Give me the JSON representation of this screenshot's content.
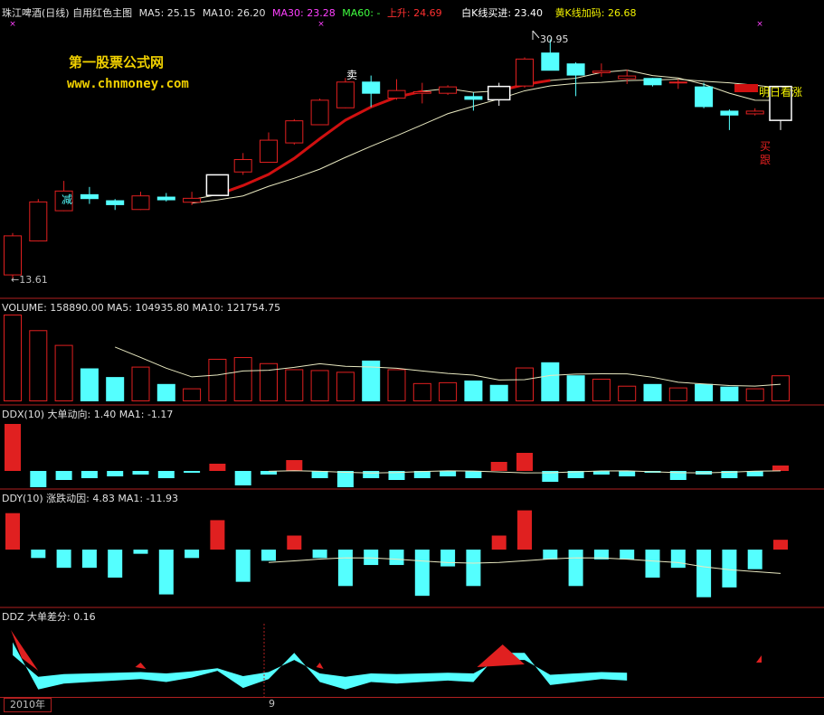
{
  "main": {
    "title": "珠江啤酒(日线) 自用红色主图",
    "ma5": "MA5: 25.15",
    "ma10": "MA10: 26.20",
    "ma30": "MA30: 23.28",
    "ma60": "MA60: -",
    "rise": "上升: 24.69",
    "white_k": "白K线买进: 23.40",
    "yellow_k": "黄K线加码: 26.68",
    "watermark_cn": "第一股票公式网",
    "watermark_url": "www.chnmoney.com",
    "high_label": "30.95",
    "low_label": "←13.61",
    "sell_label": "卖",
    "reduce_label": "减",
    "tomorrow_label": "明日看涨",
    "buy_label1": "买",
    "buy_label2": "跟"
  },
  "volume_panel": {
    "header": "VOLUME: 158890.00  MA5: 104935.80  MA10: 121754.75"
  },
  "ddx_panel": {
    "header": "DDX(10) 大单动向: 1.40  MA1: -1.17"
  },
  "ddy_panel": {
    "header": "DDY(10) 涨跌动因: 4.83  MA1: -11.93"
  },
  "ddz_panel": {
    "header": "DDZ 大单差分: 0.16"
  },
  "date_axis": {
    "year": "2010年",
    "month": "9"
  },
  "colors": {
    "up": "#e02020",
    "down": "#54ffff",
    "white": "#ffffff",
    "yellow": "#e8e8a0",
    "ma5": "#e0e0e0",
    "ma10": "#f0f000",
    "ma30": "#ff00ff",
    "ma60": "#00ff00",
    "border": "#b02020"
  },
  "candles": [
    {
      "o": 14.0,
      "c": 17.3,
      "h": 17.5,
      "l": 13.61,
      "t": "up"
    },
    {
      "o": 16.8,
      "c": 20.1,
      "h": 20.3,
      "l": 16.8,
      "t": "up"
    },
    {
      "o": 19.3,
      "c": 21.0,
      "h": 21.8,
      "l": 19.3,
      "t": "up"
    },
    {
      "o": 20.7,
      "c": 20.3,
      "h": 21.3,
      "l": 19.9,
      "t": "down"
    },
    {
      "o": 20.2,
      "c": 19.8,
      "h": 20.3,
      "l": 19.4,
      "t": "down"
    },
    {
      "o": 19.4,
      "c": 20.6,
      "h": 20.9,
      "l": 19.4,
      "t": "up"
    },
    {
      "o": 20.5,
      "c": 20.2,
      "h": 20.8,
      "l": 20.1,
      "t": "down"
    },
    {
      "o": 20.0,
      "c": 20.4,
      "h": 20.9,
      "l": 19.8,
      "t": "up"
    },
    {
      "o": 20.6,
      "c": 22.3,
      "h": 22.3,
      "l": 20.6,
      "t": "white"
    },
    {
      "o": 22.5,
      "c": 23.6,
      "h": 24.1,
      "l": 22.3,
      "t": "up"
    },
    {
      "o": 23.3,
      "c": 25.2,
      "h": 25.8,
      "l": 23.3,
      "t": "up"
    },
    {
      "o": 24.9,
      "c": 26.8,
      "h": 26.9,
      "l": 24.8,
      "t": "up"
    },
    {
      "o": 26.4,
      "c": 28.5,
      "h": 28.6,
      "l": 26.4,
      "t": "up"
    },
    {
      "o": 27.8,
      "c": 30.0,
      "h": 30.3,
      "l": 27.8,
      "t": "up"
    },
    {
      "o": 30.0,
      "c": 29.0,
      "h": 30.5,
      "l": 27.9,
      "t": "down"
    },
    {
      "o": 28.6,
      "c": 29.3,
      "h": 30.2,
      "l": 28.5,
      "t": "up"
    },
    {
      "o": 29.0,
      "c": 29.2,
      "h": 29.9,
      "l": 28.2,
      "t": "up"
    },
    {
      "o": 29.0,
      "c": 29.6,
      "h": 29.7,
      "l": 28.9,
      "t": "up"
    },
    {
      "o": 28.8,
      "c": 28.5,
      "h": 29.1,
      "l": 27.6,
      "t": "down"
    },
    {
      "o": 28.5,
      "c": 29.6,
      "h": 29.9,
      "l": 28.0,
      "t": "white"
    },
    {
      "o": 29.6,
      "c": 31.9,
      "h": 32.0,
      "l": 29.5,
      "t": "up"
    },
    {
      "o": 32.4,
      "c": 30.9,
      "h": 33.5,
      "l": 30.95,
      "t": "down"
    },
    {
      "o": 31.5,
      "c": 30.5,
      "h": 31.6,
      "l": 28.8,
      "t": "down"
    },
    {
      "o": 30.7,
      "c": 30.9,
      "h": 31.5,
      "l": 30.4,
      "t": "up"
    },
    {
      "o": 30.2,
      "c": 30.5,
      "h": 31.0,
      "l": 29.8,
      "t": "up"
    },
    {
      "o": 30.3,
      "c": 29.7,
      "h": 30.3,
      "l": 29.6,
      "t": "down"
    },
    {
      "o": 30.0,
      "c": 29.9,
      "h": 30.2,
      "l": 29.4,
      "t": "up"
    },
    {
      "o": 29.6,
      "c": 27.9,
      "h": 29.9,
      "l": 27.8,
      "t": "down"
    },
    {
      "o": 27.6,
      "c": 27.2,
      "h": 27.7,
      "l": 26.0,
      "t": "down"
    },
    {
      "o": 27.3,
      "c": 27.6,
      "h": 27.8,
      "l": 27.2,
      "t": "up"
    },
    {
      "o": 26.8,
      "c": 29.6,
      "h": 29.6,
      "l": 26.0,
      "t": "white"
    }
  ],
  "volumes": [
    {
      "v": 100,
      "t": "up"
    },
    {
      "v": 82,
      "t": "up"
    },
    {
      "v": 65,
      "t": "up"
    },
    {
      "v": 38,
      "t": "down"
    },
    {
      "v": 28,
      "t": "down"
    },
    {
      "v": 40,
      "t": "up"
    },
    {
      "v": 20,
      "t": "down"
    },
    {
      "v": 15,
      "t": "up"
    },
    {
      "v": 49,
      "t": "up"
    },
    {
      "v": 51,
      "t": "up"
    },
    {
      "v": 44,
      "t": "up"
    },
    {
      "v": 37,
      "t": "up"
    },
    {
      "v": 36,
      "t": "up"
    },
    {
      "v": 34,
      "t": "up"
    },
    {
      "v": 47,
      "t": "down"
    },
    {
      "v": 37,
      "t": "up"
    },
    {
      "v": 21,
      "t": "up"
    },
    {
      "v": 22,
      "t": "up"
    },
    {
      "v": 24,
      "t": "down"
    },
    {
      "v": 19,
      "t": "down"
    },
    {
      "v": 39,
      "t": "up"
    },
    {
      "v": 45,
      "t": "down"
    },
    {
      "v": 30,
      "t": "down"
    },
    {
      "v": 26,
      "t": "up"
    },
    {
      "v": 18,
      "t": "up"
    },
    {
      "v": 20,
      "t": "down"
    },
    {
      "v": 16,
      "t": "up"
    },
    {
      "v": 20,
      "t": "down"
    },
    {
      "v": 17,
      "t": "down"
    },
    {
      "v": 15,
      "t": "up"
    },
    {
      "v": 30,
      "t": "up"
    }
  ],
  "ddx": [
    2.6,
    -0.9,
    -0.5,
    -0.4,
    -0.3,
    -0.2,
    -0.4,
    -0.1,
    0.4,
    -0.8,
    -0.2,
    0.6,
    -0.4,
    -0.9,
    -0.4,
    -0.5,
    -0.4,
    -0.3,
    -0.4,
    0.5,
    1.0,
    -0.6,
    -0.4,
    -0.2,
    -0.3,
    -0.1,
    -0.5,
    -0.2,
    -0.4,
    -0.3,
    0.3
  ],
  "ddy": [
    2.6,
    -0.6,
    -1.3,
    -1.3,
    -2.0,
    -0.3,
    -3.2,
    -0.6,
    2.1,
    -2.3,
    -0.8,
    1.0,
    -0.6,
    -2.6,
    -1.1,
    -1.1,
    -3.3,
    -1.2,
    -2.6,
    1.0,
    2.8,
    -0.7,
    -2.6,
    -0.7,
    -0.7,
    -2.0,
    -1.3,
    -3.4,
    -2.7,
    -1.4,
    0.7
  ]
}
